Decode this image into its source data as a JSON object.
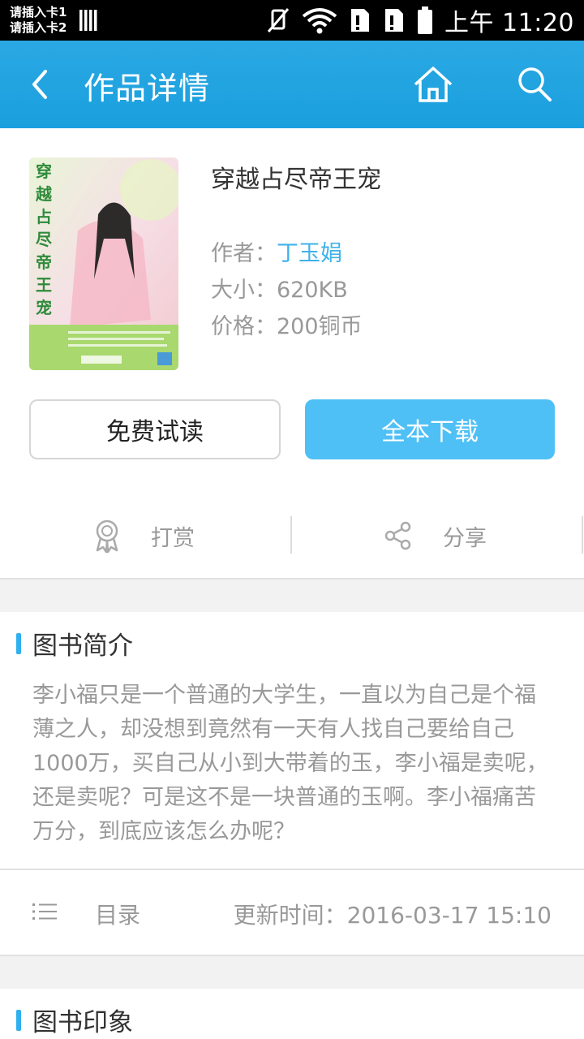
{
  "status": {
    "sim1": "请插入卡1",
    "sim2": "请插入卡2",
    "time": "上午 11:20"
  },
  "appbar": {
    "title": "作品详情"
  },
  "book": {
    "title": "穿越占尽帝王宠",
    "author_label": "作者：",
    "author": "丁玉娟",
    "size_label": "大小：",
    "size": "620KB",
    "price_label": "价格：",
    "price": "200铜币"
  },
  "buttons": {
    "read": "免费试读",
    "download": "全本下载"
  },
  "actions": {
    "reward": "打赏",
    "share": "分享"
  },
  "intro": {
    "heading": "图书简介",
    "text": "李小福只是一个普通的大学生，一直以为自己是个福薄之人，却没想到竟然有一天有人找自己要给自己1000万，买自己从小到大带着的玉，李小福是卖呢，还是卖呢？可是这不是一块普通的玉啊。李小福痛苦万分，到底应该怎么办呢？"
  },
  "toc": {
    "label": "目录",
    "update": "更新时间：2016-03-17 15:10"
  },
  "impression": {
    "heading": "图书印象"
  },
  "colors": {
    "accent": "#1aa0de",
    "download_button": "#4fc0f6",
    "author_link": "#3fb1ea"
  }
}
